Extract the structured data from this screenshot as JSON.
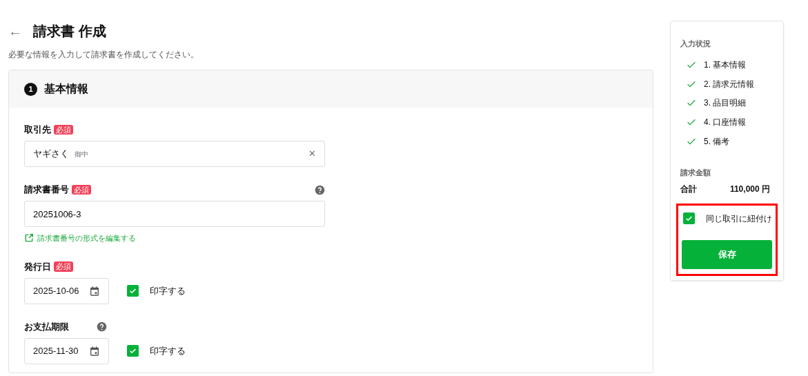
{
  "header": {
    "back": "←",
    "title": "請求書 作成",
    "subtitle": "必要な情報を入力して請求書を作成してください。"
  },
  "section": {
    "number": "1",
    "title": "基本情報"
  },
  "fields": [
    {
      "kind": "client",
      "label": "取引先",
      "required": "必須",
      "value": "ヤギさく",
      "suffix": "御中",
      "clear": "✕"
    },
    {
      "kind": "text",
      "label": "請求書番号",
      "required": "必須",
      "help": true,
      "value": "20251006-3",
      "link": "請求書番号の形式を編集する"
    },
    {
      "kind": "date",
      "label": "発行日",
      "required": "必須",
      "value": "2025-10-06",
      "print_label": "印字する",
      "print_checked": true
    },
    {
      "kind": "date",
      "label": "お支払期限",
      "help": true,
      "value": "2025-11-30",
      "print_label": "印字する",
      "print_checked": true
    }
  ],
  "status": {
    "title": "入力状況",
    "items": [
      {
        "label": "1. 基本情報",
        "done": true
      },
      {
        "label": "2. 請求元情報",
        "done": true
      },
      {
        "label": "3. 品目明細",
        "done": true
      },
      {
        "label": "4. 口座情報",
        "done": true
      },
      {
        "label": "5. 備考",
        "done": true
      }
    ]
  },
  "amount": {
    "title": "請求金額",
    "total_label": "合計",
    "total": "110,000 円"
  },
  "link_deal": {
    "label": "同じ取引に紐付け",
    "checked": true,
    "highlighted": true
  },
  "save_button": "保存"
}
